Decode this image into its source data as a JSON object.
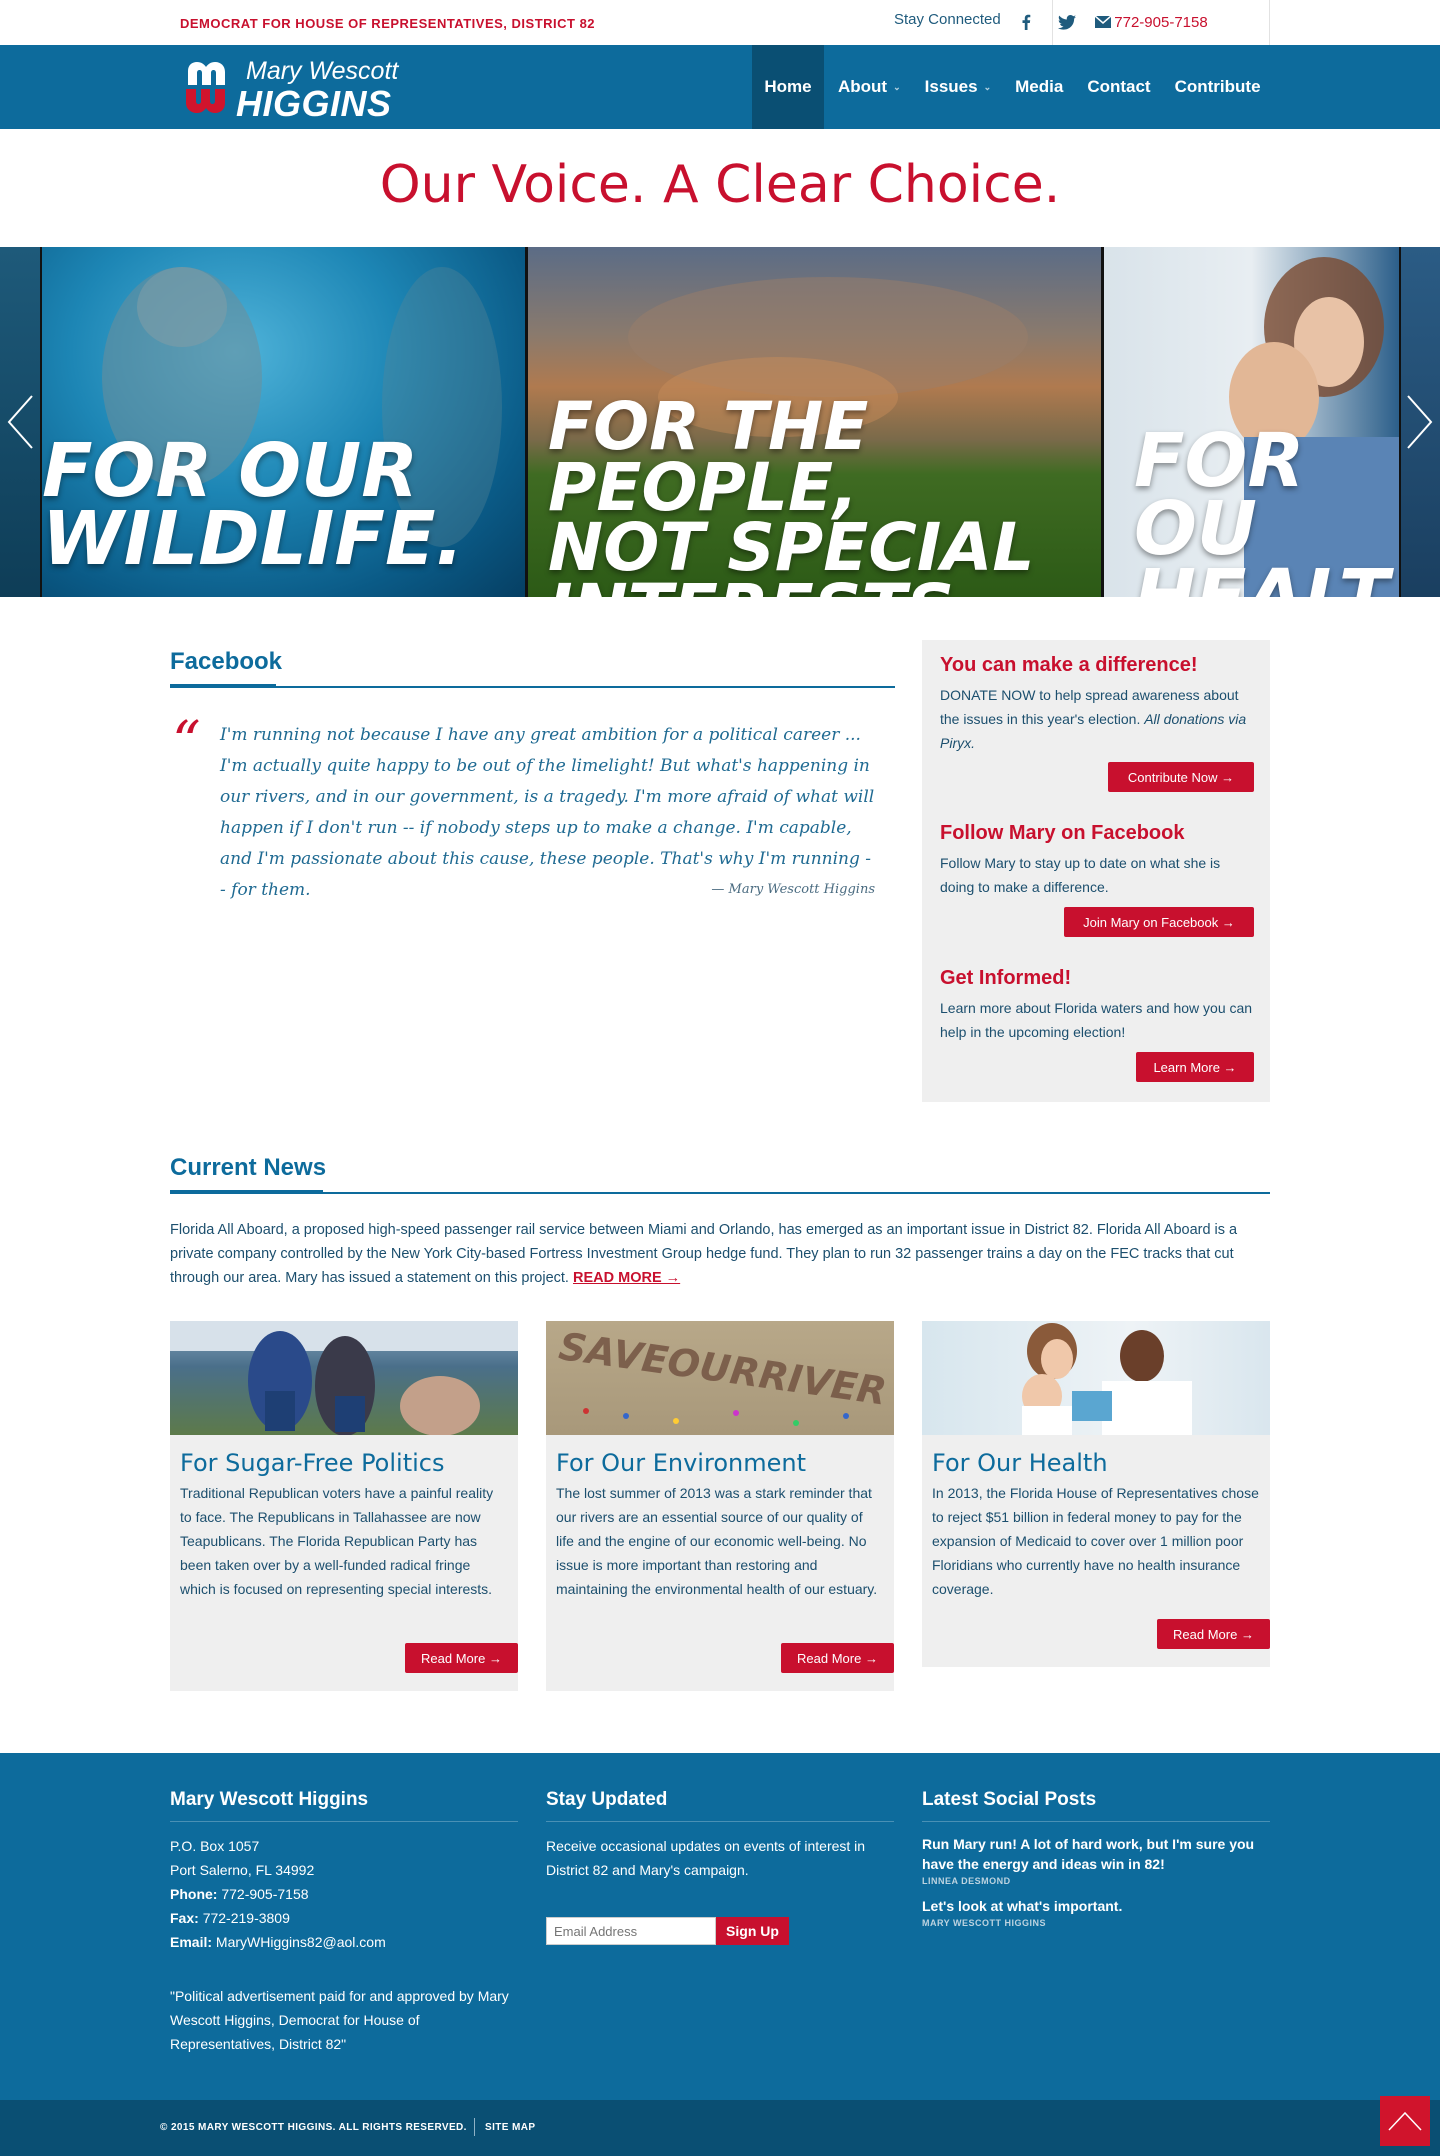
{
  "topbar": {
    "tagline": "DEMOCRAT FOR HOUSE OF REPRESENTATIVES, DISTRICT 82",
    "stay_connected": "Stay Connected",
    "phone": "772-905-7158"
  },
  "logo": {
    "name": "Mary Wescott",
    "last": "HIGGINS"
  },
  "nav": {
    "items": [
      {
        "label": "Home"
      },
      {
        "label": "About"
      },
      {
        "label": "Issues"
      },
      {
        "label": "Media"
      },
      {
        "label": "Contact"
      },
      {
        "label": "Contribute"
      }
    ]
  },
  "hero": {
    "slogan": "Our Voice. A Clear Choice.",
    "slides": [
      {
        "line1": "FOR OUR",
        "line2": "WILDLIFE."
      },
      {
        "line1": "FOR THE PEOPLE,",
        "line2": "NOT SPECIAL",
        "line3": "INTERESTS."
      },
      {
        "line1": "FOR OU",
        "line2": "HEALT"
      }
    ]
  },
  "facebook": {
    "title": "Facebook",
    "quote": "I'm running not because I have any great ambition for a political career ... I'm actually quite happy to be out of the limelight! But what's happening in our rivers, and in our government, is a tragedy. I'm more afraid of what will happen if I don't run -- if nobody steps up to make a change. I'm capable, and I'm passionate about this cause, these people. That's why I'm running -- for them.",
    "author": "— Mary Wescott Higgins"
  },
  "sidebar": {
    "blocks": [
      {
        "title": "You can make a difference!",
        "text": "DONATE NOW to help spread awareness about the issues in this year's election.",
        "text_em": "All donations via Piryx.",
        "button": "Contribute Now →"
      },
      {
        "title": "Follow Mary on Facebook",
        "text": "Follow Mary to stay up to date on what she is doing to make a difference.",
        "button": "Join Mary on Facebook →"
      },
      {
        "title": "Get Informed!",
        "text": "Learn more about Florida waters and how you can help in the upcoming election!",
        "button": "Learn More →"
      }
    ]
  },
  "news": {
    "title": "Current News",
    "intro": "Florida All Aboard, a proposed high-speed passenger rail service between Miami and Orlando, has emerged as an important issue in District 82. Florida All Aboard is a private company controlled by the New York City-based Fortress Investment Group hedge fund. They plan to run 32 passenger trains a day on the FEC tracks that cut through our area. Mary has issued a statement on this project.",
    "read_more": "READ MORE →",
    "cards": [
      {
        "title": "For Sugar-Free Politics",
        "text": "Traditional Republican voters have a painful reality to face. The Republicans in Tallahassee are now Teapublicans. The Florida Republican Party has been taken over by a well-funded radical fringe which is focused on representing special interests.",
        "button": "Read More →"
      },
      {
        "title": "For Our Environment",
        "text": "The lost summer of 2013 was a stark reminder that our rivers are an essential source of our quality of life and the engine of our economic well-being. No issue is more important than restoring and maintaining the environmental health of our estuary.",
        "button": "Read More →"
      },
      {
        "title": "For Our Health",
        "text": "In 2013, the Florida House of Representatives chose to reject $51 billion in federal money to pay for the expansion of Medicaid to cover over 1 million poor Floridians who currently have no health insurance coverage.",
        "button": "Read More →"
      }
    ]
  },
  "footer": {
    "contact": {
      "title": "Mary Wescott Higgins",
      "address1": "P.O. Box 1057",
      "address2": "Port Salerno, FL 34992",
      "phone_label": "Phone:",
      "phone": "772-905-7158",
      "fax_label": "Fax:",
      "fax": "772-219-3809",
      "email_label": "Email:",
      "email": "MaryWHiggins82@aol.com",
      "disclaimer": "\"Political advertisement paid for and approved by Mary Wescott Higgins, Democrat for House of Representatives, District 82\""
    },
    "updates": {
      "title": "Stay Updated",
      "text": "Receive occasional updates on events of interest in District 82 and Mary's campaign.",
      "email_placeholder": "Email Address",
      "signup": "Sign Up"
    },
    "social": {
      "title": "Latest Social Posts",
      "posts": [
        {
          "text": "Run Mary run! A lot of hard work, but I'm sure you have the energy and ideas win in 82!",
          "author": "LINNEA DESMOND"
        },
        {
          "text": "Let's look at what's important.",
          "author": "MARY WESCOTT HIGGINS"
        }
      ]
    },
    "copyright": "© 2015 MARY WESCOTT HIGGINS. ALL RIGHTS RESERVED.",
    "sitemap": "SITE MAP"
  },
  "colors": {
    "brand_blue": "#0d6b9c",
    "dark_blue": "#0a4f73",
    "accent_red": "#c8102e"
  }
}
